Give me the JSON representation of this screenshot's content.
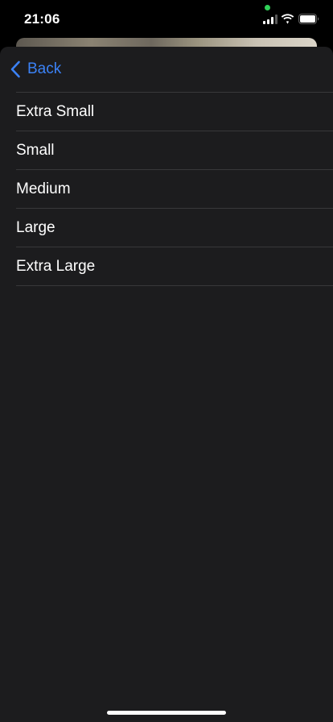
{
  "status_bar": {
    "time": "21:06",
    "icons": [
      "cellular-signal-icon",
      "wifi-icon",
      "battery-icon"
    ],
    "camera_indicator_color": "#30d158"
  },
  "nav": {
    "back_label": "Back",
    "back_icon": "chevron-left-icon"
  },
  "options": [
    {
      "label": "Extra Small"
    },
    {
      "label": "Small"
    },
    {
      "label": "Medium"
    },
    {
      "label": "Large"
    },
    {
      "label": "Extra Large"
    }
  ],
  "colors": {
    "accent": "#3b82f6",
    "sheet_background": "#1c1c1e",
    "separator": "#38383a",
    "text": "#ffffff"
  }
}
